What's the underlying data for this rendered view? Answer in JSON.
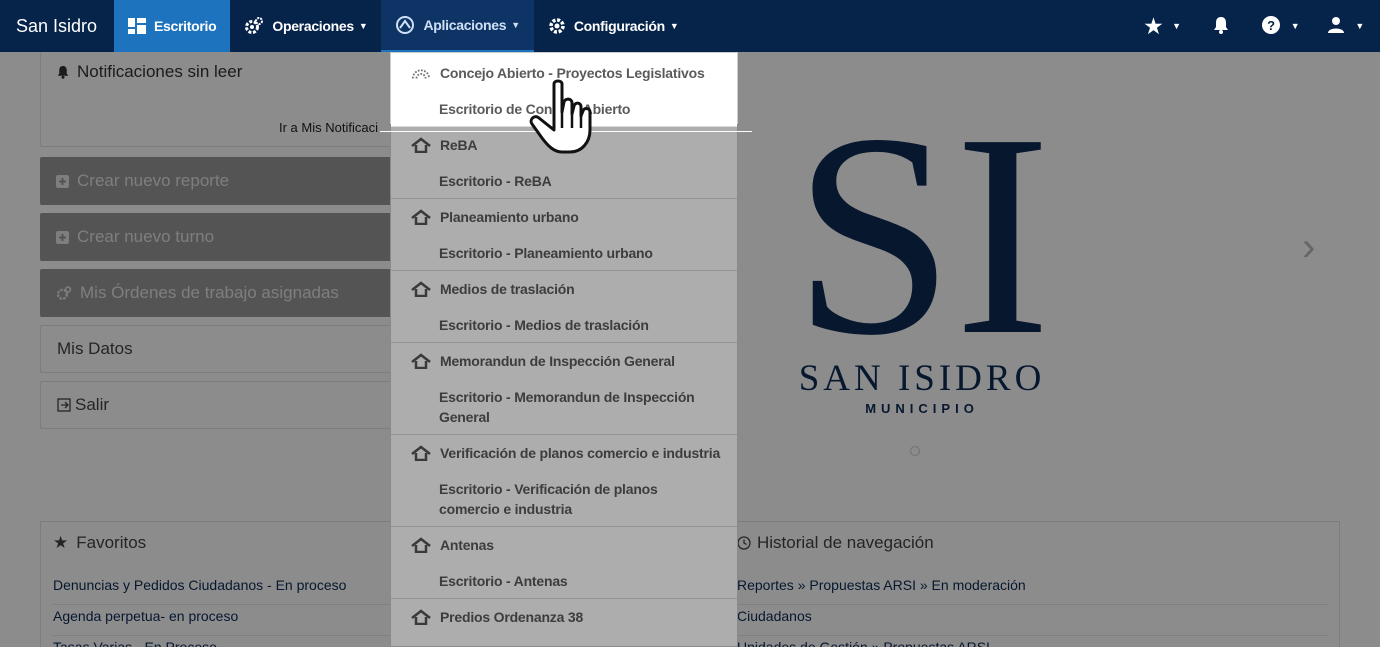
{
  "navbar": {
    "brand": "San Isidro",
    "items": [
      {
        "label": "Escritorio",
        "icon": "dashboard-icon"
      },
      {
        "label": "Operaciones",
        "icon": "gears-icon"
      },
      {
        "label": "Aplicaciones",
        "icon": "apps-icon"
      },
      {
        "label": "Configuración",
        "icon": "gear-icon"
      }
    ],
    "right_icons": [
      "star-icon",
      "bell-icon",
      "help-icon",
      "user-icon"
    ]
  },
  "notifications": {
    "title": "Notificaciones sin leer",
    "link": "Ir a Mis Notificaci"
  },
  "actions": [
    {
      "label": "Crear nuevo reporte",
      "icon": "plus-square-icon"
    },
    {
      "label": "Crear nuevo turno",
      "icon": "plus-square-icon"
    },
    {
      "label": "Mis Órdenes de trabajo asignadas",
      "icon": "gears-icon"
    }
  ],
  "boxes": [
    {
      "label": "Mis Datos"
    },
    {
      "label": "Salir",
      "icon": "sign-out-icon"
    }
  ],
  "carousel": {
    "logo_text": "SI",
    "logo_name": "SAN ISIDRO",
    "logo_sub": "MUNICIPIO"
  },
  "favoritos": {
    "title": "Favoritos",
    "items": [
      "Denuncias y Pedidos Ciudadanos - En proceso",
      "Agenda perpetua- en proceso",
      "Tasas Varias - En Proceso"
    ]
  },
  "historial": {
    "title": "Historial de navegación",
    "items": [
      "Reportes » Propuestas ARSI » En moderación",
      "Ciudadanos",
      "Unidades de Gestión » Propuestas ARSI"
    ]
  },
  "dropdown": {
    "sections": [
      {
        "header": "Concejo Abierto - Proyectos Legislativos",
        "sub": "Escritorio de Concejo Abierto",
        "icon": "dome-icon"
      },
      {
        "header": "ReBA",
        "sub": "Escritorio - ReBA",
        "icon": "home-icon"
      },
      {
        "header": "Planeamiento urbano",
        "sub": "Escritorio - Planeamiento urbano",
        "icon": "home-icon"
      },
      {
        "header": "Medios de traslación",
        "sub": "Escritorio - Medios de traslación",
        "icon": "home-icon"
      },
      {
        "header": "Memorandun de Inspección General",
        "sub": "Escritorio - Memorandun de Inspección General",
        "icon": "home-icon"
      },
      {
        "header": "Verificación de planos comercio e industria",
        "sub": "Escritorio - Verificación de planos comercio e industria",
        "icon": "home-icon"
      },
      {
        "header": "Antenas",
        "sub": "Escritorio - Antenas",
        "icon": "home-icon"
      },
      {
        "header": "Predios Ordenanza 38",
        "sub": "",
        "icon": "home-icon"
      }
    ]
  },
  "colors": {
    "navbar": "#06234a",
    "active": "#1e73be",
    "logo": "#0b2a55"
  }
}
